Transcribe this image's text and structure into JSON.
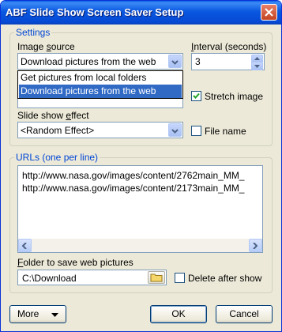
{
  "window": {
    "title": "ABF Slide Show Screen Saver Setup"
  },
  "settings": {
    "group_title": "Settings",
    "image_source": {
      "label_pre": "Image ",
      "label_u": "s",
      "label_post": "ource",
      "value": "Download pictures from the web",
      "options": [
        "Get pictures from local folders",
        "Download pictures from the web"
      ],
      "selected_index": 1
    },
    "interval": {
      "label_pre": "",
      "label_u": "I",
      "label_post": "nterval (seconds)",
      "value": "3"
    },
    "stretch_image": {
      "label": "Stretch image",
      "checked": true
    },
    "slideshow_effect": {
      "label_pre": "Slide show ",
      "label_u": "e",
      "label_post": "ffect",
      "value": "<Random Effect>"
    },
    "file_name": {
      "label": "File name",
      "checked": false
    }
  },
  "urls": {
    "group_title": "URLs (one per line)",
    "lines": [
      "http://www.nasa.gov/images/content/2762main_MM_",
      "http://www.nasa.gov/images/content/2173main_MM_"
    ]
  },
  "folder": {
    "label_pre": "",
    "label_u": "F",
    "label_post": "older to save web pictures",
    "value": "C:\\Download",
    "delete_after_show": {
      "label": "Delete after show",
      "checked": false
    }
  },
  "buttons": {
    "more": "More",
    "ok": "OK",
    "cancel": "Cancel"
  },
  "colors": {
    "title_bar": "#0a58e0",
    "group_title": "#0046d5",
    "selection": "#316ac5"
  }
}
